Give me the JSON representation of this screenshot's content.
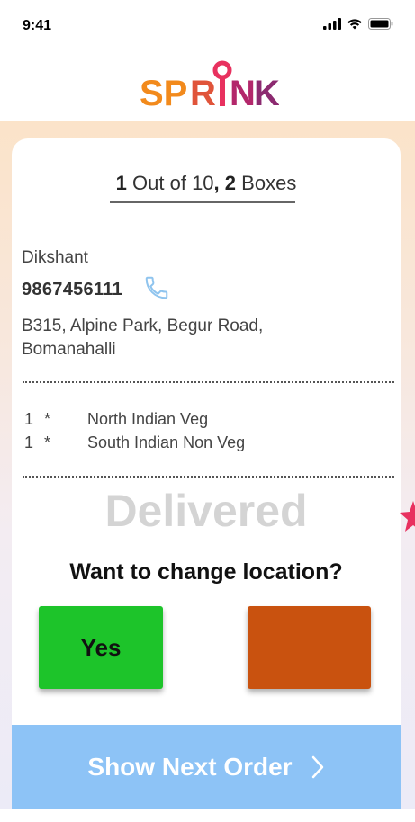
{
  "status_bar": {
    "time": "9:41"
  },
  "brand": {
    "logo_text": "SPRINK",
    "colors": {
      "orange": "#f28a1c",
      "magenta": "#b3276b",
      "purple": "#8c2a70"
    }
  },
  "order": {
    "progress_current": "1",
    "progress_mid": "Out of 10",
    "progress_comma": ",",
    "progress_boxes_count": "2",
    "progress_boxes_label": "Boxes",
    "customer_name": "Dikshant",
    "phone": "9867456111",
    "address_line1": "B315, Alpine Park, Begur Road,",
    "address_line2": "Bomanahalli",
    "items": [
      {
        "qty": "1",
        "sep": "*",
        "name": "North Indian Veg"
      },
      {
        "qty": "1",
        "sep": "*",
        "name": "South Indian Non Veg"
      }
    ],
    "status": "Delivered"
  },
  "location_prompt": {
    "question": "Want to change location?",
    "yes_label": "Yes"
  },
  "next_button": {
    "label": "Show Next Order"
  },
  "colors": {
    "yes_button": "#1dc42a",
    "no_button": "#c9520f",
    "next_button": "#8dc3f6",
    "status_delivered": "#d4d4d4",
    "phone_icon": "#8fc4ee"
  },
  "icons": [
    "signal-icon",
    "wifi-icon",
    "battery-icon",
    "phone-icon",
    "chevron-right-icon",
    "star-icon"
  ]
}
